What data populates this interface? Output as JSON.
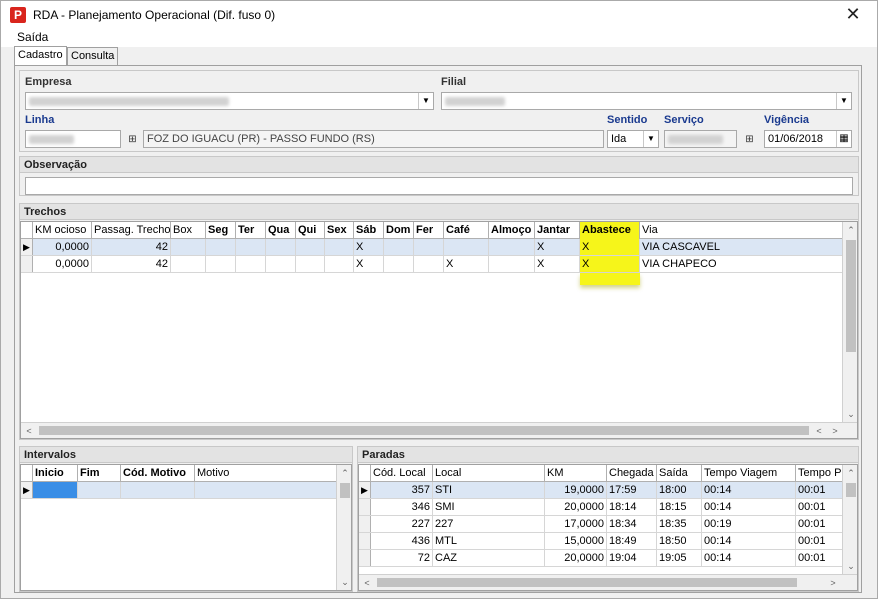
{
  "window": {
    "title": "RDA - Planejamento Operacional (Dif. fuso 0)",
    "app_icon_glyph": "P",
    "close_glyph": "✕",
    "accent": "#d9251d"
  },
  "menu": {
    "exit_label": "Saída"
  },
  "tabs": [
    {
      "label": "Cadastro",
      "active": true
    },
    {
      "label": "Consulta",
      "active": false
    }
  ],
  "form": {
    "empresa_label": "Empresa",
    "filial_label": "Filial",
    "linha_label": "Linha",
    "linha_desc": "FOZ DO IGUACU (PR) - PASSO FUNDO (RS)",
    "sentido_label": "Sentido",
    "sentido_value": "Ida",
    "servico_label": "Serviço",
    "vigencia_label": "Vigência",
    "vigencia_value": "01/06/2018"
  },
  "observacao": {
    "title": "Observação",
    "value": ""
  },
  "trechos": {
    "title": "Trechos",
    "columns": [
      "KM ocioso",
      "Passag. Trecho",
      "Box",
      "Seg",
      "Ter",
      "Qua",
      "Qui",
      "Sex",
      "Sáb",
      "Dom",
      "Fer",
      "Café",
      "Almoço",
      "Jantar",
      "Abastece",
      "Via"
    ],
    "rows": [
      [
        "0,0000",
        "42",
        "",
        "",
        "",
        "",
        "",
        "",
        "X",
        "",
        "",
        "",
        "",
        "X",
        "X",
        "VIA CASCAVEL"
      ],
      [
        "0,0000",
        "42",
        "",
        "",
        "",
        "",
        "",
        "",
        "X",
        "",
        "",
        "X",
        "",
        "X",
        "X",
        "VIA CHAPECO"
      ]
    ],
    "highlight_color": "#f6f51a"
  },
  "intervalos": {
    "title": "Intervalos",
    "columns": [
      "Inicio",
      "Fim",
      "Cód. Motivo",
      "Motivo"
    ]
  },
  "paradas": {
    "title": "Paradas",
    "columns": [
      "Cód. Local",
      "Local",
      "KM",
      "Chegada",
      "Saída",
      "Tempo Viagem",
      "Tempo P"
    ],
    "rows": [
      [
        "357",
        "STI",
        "19,0000",
        "17:59",
        "18:00",
        "00:14",
        "00:01"
      ],
      [
        "346",
        "SMI",
        "20,0000",
        "18:14",
        "18:15",
        "00:14",
        "00:01"
      ],
      [
        "227",
        "227",
        "17,0000",
        "18:34",
        "18:35",
        "00:19",
        "00:01"
      ],
      [
        "436",
        "MTL",
        "15,0000",
        "18:49",
        "18:50",
        "00:14",
        "00:01"
      ],
      [
        "72",
        "CAZ",
        "20,0000",
        "19:04",
        "19:05",
        "00:14",
        "00:01"
      ]
    ]
  },
  "icons": {
    "row_pointer": "▶",
    "dropdown": "▼",
    "scroll_up": "⌃",
    "scroll_down": "⌄",
    "scroll_left": "<",
    "scroll_right": ">",
    "lookup": "⊞",
    "calendar": "▦"
  }
}
